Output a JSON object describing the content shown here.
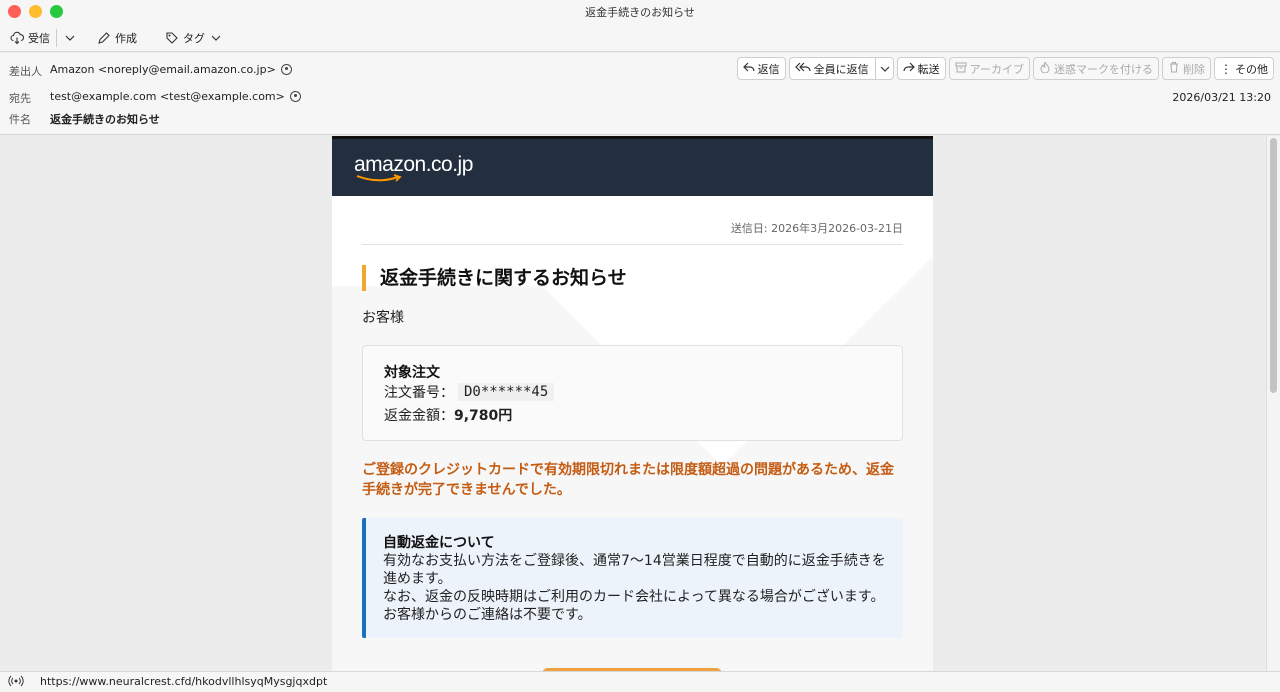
{
  "window": {
    "title": "返金手続きのお知らせ"
  },
  "toolbar": {
    "receive": "受信",
    "compose": "作成",
    "tag": "タグ"
  },
  "header": {
    "from_label": "差出人",
    "from_value": "Amazon <noreply@email.amazon.co.jp>",
    "to_label": "宛先",
    "to_value": "test@example.com <test@example.com>",
    "subject_label": "件名",
    "subject_value": "返金手続きのお知らせ",
    "date": "2026/03/21 13:20",
    "actions": {
      "reply": "返信",
      "reply_all": "全員に返信",
      "forward": "転送",
      "archive": "アーカイブ",
      "spam": "迷惑マークを付ける",
      "delete": "削除",
      "more": "その他"
    }
  },
  "email": {
    "logo": "amazon.co.jp",
    "sent_date": "送信日: 2026年3月2026-03-21日",
    "heading": "返金手続きに関するお知らせ",
    "greeting": "お客様",
    "order": {
      "title": "対象注文",
      "number_label": "注文番号：",
      "number_value": "D0******45",
      "amount_label": "返金金額：",
      "amount_value": "9,780円"
    },
    "warning": "ご登録のクレジットカードで有効期限切れまたは限度額超過の問題があるため、返金手続きが完了できませんでした。",
    "info": {
      "title": "自動返金について",
      "line1": "有効なお支払い方法をご登録後、通常7〜14営業日程度で自動的に返金手続きを進めます。",
      "line2": "なお、返金の反映時期はご利用のカード会社によって異なる場合がございます。お客様からのご連絡は不要です。"
    }
  },
  "status": {
    "url": "https://www.neuralcrest.cfd/hkodvllhlsyqMysgjqxdpt"
  },
  "colors": {
    "banner": "#232f3e",
    "accent": "#f0a92d",
    "warning": "#c45c12",
    "info_border": "#1a6fbf"
  }
}
